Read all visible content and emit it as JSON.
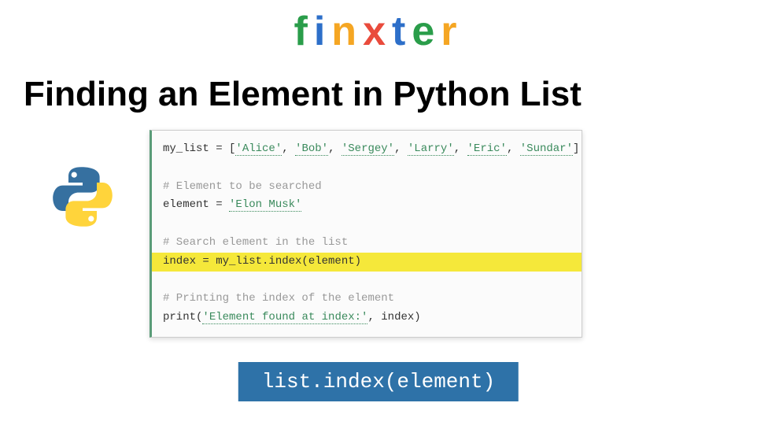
{
  "logo": {
    "letters": [
      {
        "char": "f",
        "color": "#2a9d4a"
      },
      {
        "char": "i",
        "color": "#2d6fc9"
      },
      {
        "char": "n",
        "color": "#f5a623"
      },
      {
        "char": "x",
        "color": "#e94b3c"
      },
      {
        "char": "t",
        "color": "#2d6fc9"
      },
      {
        "char": "e",
        "color": "#2a9d4a"
      },
      {
        "char": "r",
        "color": "#f5a623"
      }
    ]
  },
  "heading": "Finding an Element in Python List",
  "code": {
    "line1_pre": "my_list = [",
    "line1_strings": [
      "'Alice'",
      "'Bob'",
      "'Sergey'",
      "'Larry'",
      "'Eric'",
      "'Sundar'"
    ],
    "line1_post": "]",
    "comment1": "# Element to be searched",
    "line2_pre": "element = ",
    "line2_string": "'Elon Musk'",
    "comment2": "# Search element in the list",
    "line3": "index = my_list.index(element)",
    "comment3": "# Printing the index of the element",
    "line4_pre": "print(",
    "line4_string": "'Element found at index:'",
    "line4_post": ", index)"
  },
  "method_banner": "list.index(element)"
}
